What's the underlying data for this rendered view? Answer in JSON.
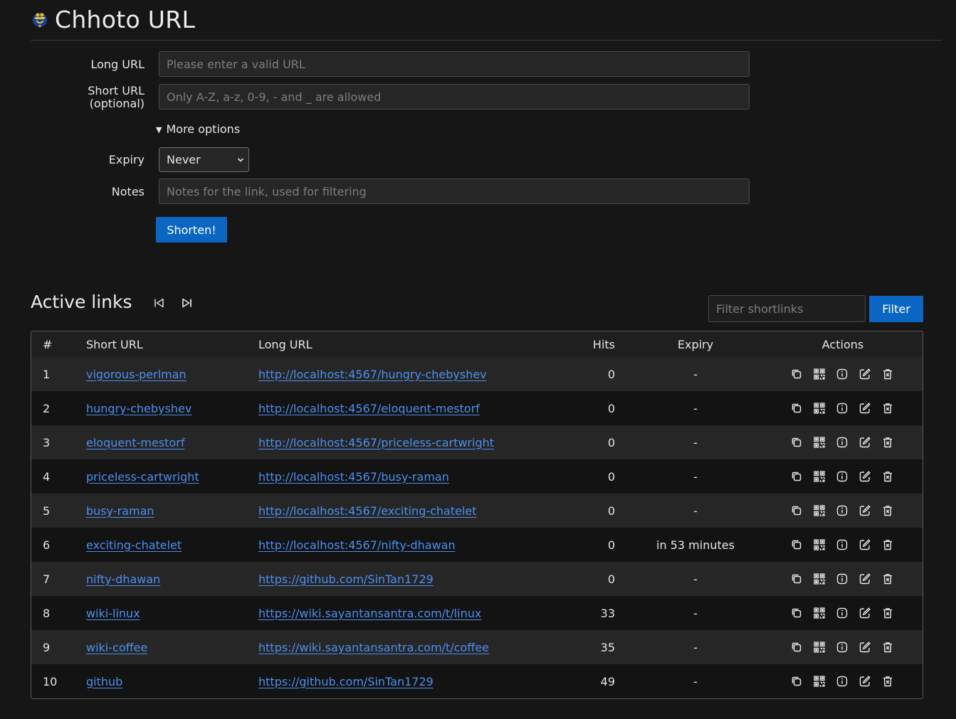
{
  "app": {
    "title": "Chhoto URL"
  },
  "form": {
    "long_url_label": "Long URL",
    "long_url_placeholder": "Please enter a valid URL",
    "short_url_label": "Short URL",
    "short_url_label_sub": "(optional)",
    "short_url_placeholder": "Only A-Z, a-z, 0-9, - and _ are allowed",
    "more_options": "More options",
    "expiry_label": "Expiry",
    "expiry_value": "Never",
    "notes_label": "Notes",
    "notes_placeholder": "Notes for the link, used for filtering",
    "submit_label": "Shorten!"
  },
  "links": {
    "title": "Active links",
    "filter_placeholder": "Filter shortlinks",
    "filter_button": "Filter",
    "columns": {
      "num": "#",
      "short": "Short URL",
      "long": "Long URL",
      "hits": "Hits",
      "expiry": "Expiry",
      "actions": "Actions"
    },
    "rows": [
      {
        "num": "1",
        "short": "vigorous-perlman",
        "long": "http://localhost:4567/hungry-chebyshev",
        "hits": "0",
        "expiry": "-"
      },
      {
        "num": "2",
        "short": "hungry-chebyshev",
        "long": "http://localhost:4567/eloquent-mestorf",
        "hits": "0",
        "expiry": "-"
      },
      {
        "num": "3",
        "short": "eloquent-mestorf",
        "long": "http://localhost:4567/priceless-cartwright",
        "hits": "0",
        "expiry": "-"
      },
      {
        "num": "4",
        "short": "priceless-cartwright",
        "long": "http://localhost:4567/busy-raman",
        "hits": "0",
        "expiry": "-"
      },
      {
        "num": "5",
        "short": "busy-raman",
        "long": "http://localhost:4567/exciting-chatelet",
        "hits": "0",
        "expiry": "-"
      },
      {
        "num": "6",
        "short": "exciting-chatelet",
        "long": "http://localhost:4567/nifty-dhawan",
        "hits": "0",
        "expiry": "in 53 minutes"
      },
      {
        "num": "7",
        "short": "nifty-dhawan",
        "long": "https://github.com/SinTan1729",
        "hits": "0",
        "expiry": "-"
      },
      {
        "num": "8",
        "short": "wiki-linux",
        "long": "https://wiki.sayantansantra.com/t/linux",
        "hits": "33",
        "expiry": "-"
      },
      {
        "num": "9",
        "short": "wiki-coffee",
        "long": "https://wiki.sayantansantra.com/t/coffee",
        "hits": "35",
        "expiry": "-"
      },
      {
        "num": "10",
        "short": "github",
        "long": "https://github.com/SinTan1729",
        "hits": "49",
        "expiry": "-"
      }
    ]
  },
  "icons": [
    "copy-icon",
    "qr-code-icon",
    "info-icon",
    "edit-icon",
    "delete-icon"
  ],
  "colors": {
    "background": "#161616",
    "accent": "#0a66c2",
    "link": "#4c8ff0"
  }
}
